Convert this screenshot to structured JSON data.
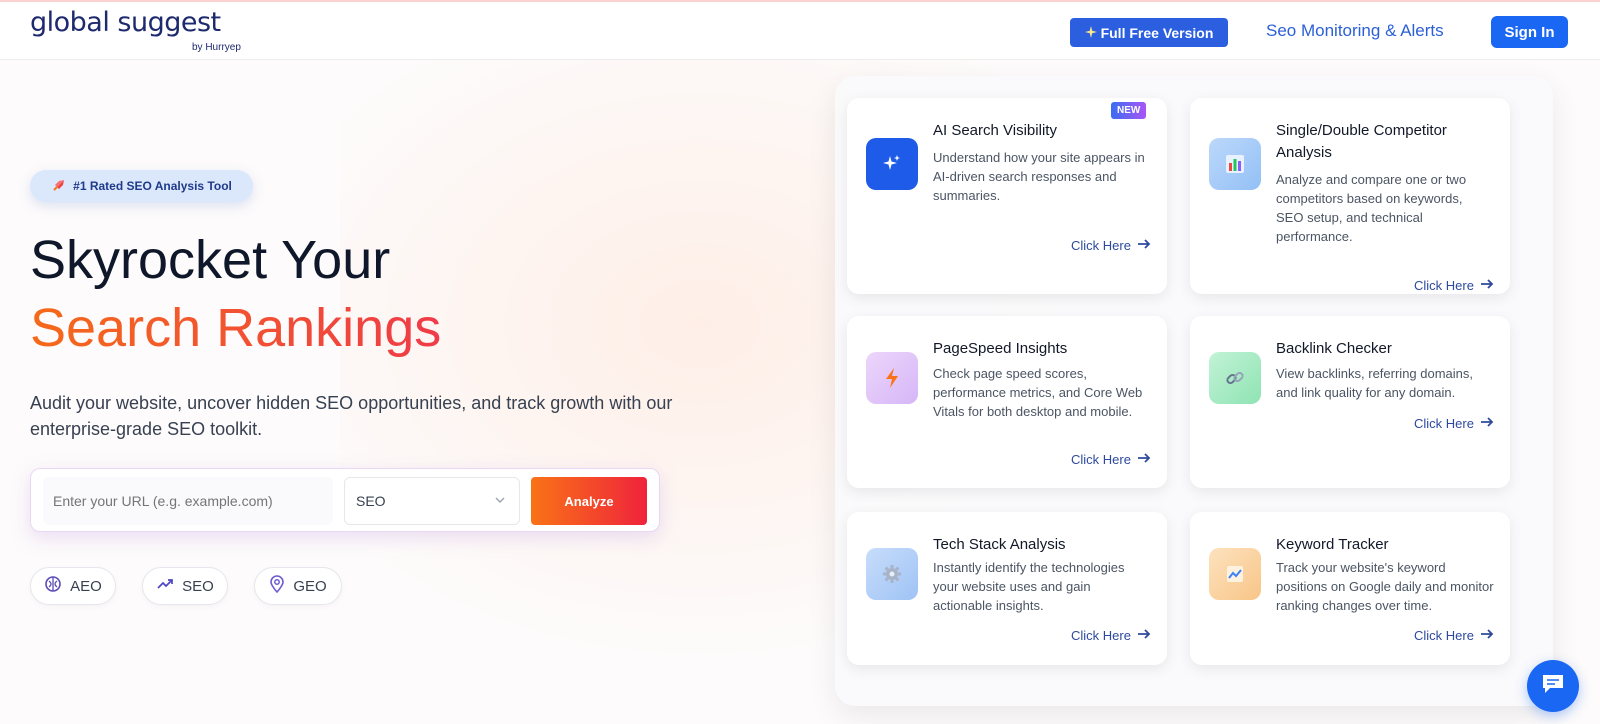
{
  "header": {
    "logo_main": "global suggest",
    "logo_sub": "by Hurryep",
    "free_button": "Full Free Version",
    "nav_link": "Seo Monitoring & Alerts",
    "signin_button": "Sign In"
  },
  "hero": {
    "badge": "#1 Rated SEO Analysis Tool",
    "title_line1": "Skyrocket Your",
    "title_line2": "Search Rankings",
    "subtitle": "Audit your website, uncover hidden SEO opportunities, and track growth with our enterprise-grade SEO toolkit.",
    "url_placeholder": "Enter your URL (e.g. example.com)",
    "select_value": "SEO",
    "analyze_button": "Analyze",
    "chips": [
      "AEO",
      "SEO",
      "GEO"
    ]
  },
  "cards": [
    {
      "title": "AI Search Visibility",
      "desc": "Understand how your site appears in AI-driven search responses and summaries.",
      "link": "Click Here",
      "badge": "NEW"
    },
    {
      "title": "Single/Double Competitor Analysis",
      "desc": "Analyze and compare one or two competitors based on keywords, SEO setup, and technical performance.",
      "link": "Click Here"
    },
    {
      "title": "PageSpeed Insights",
      "desc": "Check page speed scores, performance metrics, and Core Web Vitals for both desktop and mobile.",
      "link": "Click Here"
    },
    {
      "title": "Backlink Checker",
      "desc": "View backlinks, referring domains, and link quality for any domain.",
      "link": "Click Here"
    },
    {
      "title": "Tech Stack Analysis",
      "desc": "Instantly identify the technologies your website uses and gain actionable insights.",
      "link": "Click Here"
    },
    {
      "title": "Keyword Tracker",
      "desc": "Track your website's keyword positions on Google daily and monitor ranking changes over time.",
      "link": "Click Here"
    }
  ],
  "colors": {
    "primary_blue": "#1967f2",
    "accent_orange": "#f97316",
    "accent_red": "#ef233c"
  }
}
